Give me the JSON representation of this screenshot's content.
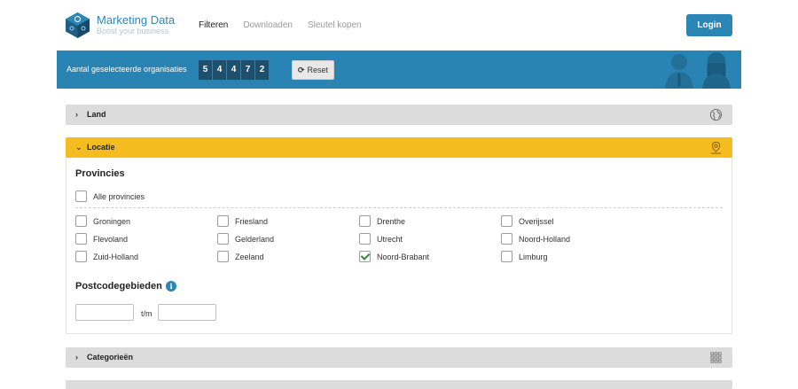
{
  "brand": {
    "name": "Marketing Data",
    "tagline": "Boost your business"
  },
  "nav": [
    {
      "label": "Filteren",
      "active": true
    },
    {
      "label": "Downloaden",
      "active": false
    },
    {
      "label": "Sleutel kopen",
      "active": false
    }
  ],
  "login_label": "Login",
  "selection": {
    "label": "Aantal geselecteerde organisaties",
    "digits": [
      "5",
      "4",
      "4",
      "7",
      "2"
    ],
    "reset_label": "Reset"
  },
  "panels": {
    "land": {
      "title": "Land",
      "icon": "globe-icon"
    },
    "locatie": {
      "title": "Locatie",
      "icon": "map-pin-icon"
    },
    "categorieen": {
      "title": "Categorieën",
      "icon": "grid-icon"
    }
  },
  "provincies": {
    "title": "Provincies",
    "all_label": "Alle provincies",
    "items": [
      {
        "label": "Groningen",
        "checked": false
      },
      {
        "label": "Friesland",
        "checked": false
      },
      {
        "label": "Drenthe",
        "checked": false
      },
      {
        "label": "Overijssel",
        "checked": false
      },
      {
        "label": "Flevoland",
        "checked": false
      },
      {
        "label": "Gelderland",
        "checked": false
      },
      {
        "label": "Utrecht",
        "checked": false
      },
      {
        "label": "Noord-Holland",
        "checked": false
      },
      {
        "label": "Zuid-Holland",
        "checked": false
      },
      {
        "label": "Zeeland",
        "checked": false
      },
      {
        "label": "Noord-Brabant",
        "checked": true
      },
      {
        "label": "Limburg",
        "checked": false
      }
    ]
  },
  "postcode": {
    "title": "Postcodegebieden",
    "from_value": "",
    "to_label": "t/m",
    "to_value": ""
  },
  "colors": {
    "accent": "#2a84b3",
    "open_panel": "#f5bc22",
    "counter": "#1d4f6e"
  }
}
